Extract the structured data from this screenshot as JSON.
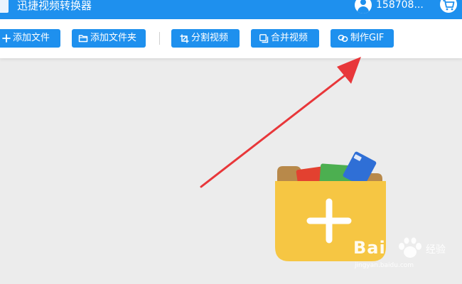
{
  "titlebar": {
    "app_title": "迅捷视频转换器",
    "user_name": "158708..."
  },
  "toolbar": {
    "buttons": [
      {
        "label": "添加文件",
        "icon": "plus-icon"
      },
      {
        "label": "添加文件夹",
        "icon": "folder-icon"
      },
      {
        "label": "分割视频",
        "icon": "crop-icon"
      },
      {
        "label": "合并视频",
        "icon": "merge-icon"
      },
      {
        "label": "制作GIF",
        "icon": "link-icon"
      }
    ]
  },
  "main": {
    "drop_zone_icon": "folder-add-icon",
    "annotation": "red-arrow-pointing-to-make-gif"
  },
  "watermark": {
    "brand": "Bai",
    "brand_suffix": "经验",
    "url": "jingyan.baidu.com"
  },
  "colors": {
    "primary": "#1e90ee",
    "background": "#ececec",
    "toolbar": "#ffffff",
    "folder": "#f6c643",
    "arrow": "#e8373a"
  }
}
